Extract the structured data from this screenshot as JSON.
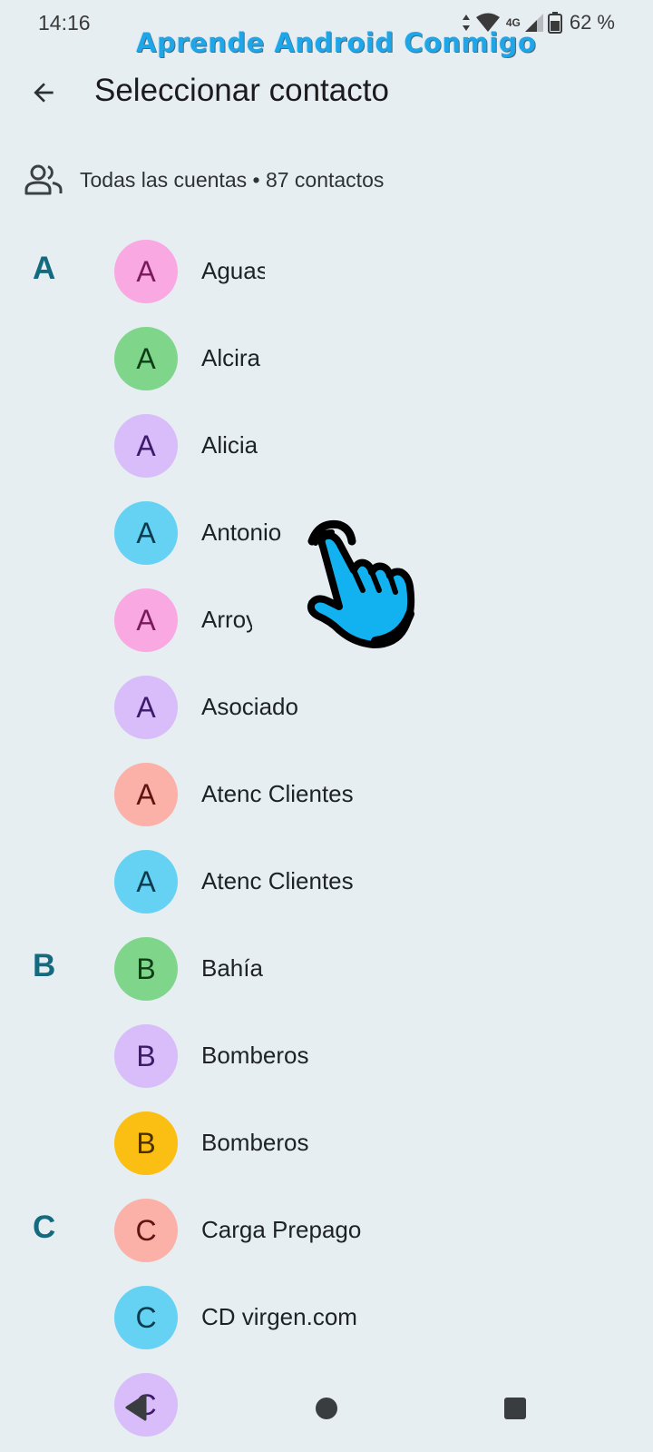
{
  "status_bar": {
    "time": "14:16",
    "network": "4G",
    "battery": "62 %"
  },
  "watermark": "Aprende Android Conmigo",
  "header": {
    "back_icon": "arrow-back-icon",
    "title": "Seleccionar contacto"
  },
  "account_filter": {
    "icon": "people-icon",
    "label": "Todas las cuentas • 87 contactos"
  },
  "contacts": [
    {
      "section": "A",
      "initial": "A",
      "name": "Aguas",
      "bg": "#f9a8e2",
      "fg": "#7a1a5e"
    },
    {
      "section": "",
      "initial": "A",
      "name": "Alcira",
      "bg": "#7fd68a",
      "fg": "#0f3d17"
    },
    {
      "section": "",
      "initial": "A",
      "name": "Alicia",
      "bg": "#d8bdfa",
      "fg": "#3e1a6a"
    },
    {
      "section": "",
      "initial": "A",
      "name": "Antonio",
      "bg": "#66d2f3",
      "fg": "#0b3b4d"
    },
    {
      "section": "",
      "initial": "A",
      "name": "Arroyo",
      "bg": "#f9a8e2",
      "fg": "#7a1a5e"
    },
    {
      "section": "",
      "initial": "A",
      "name": "Asociado",
      "bg": "#d8bdfa",
      "fg": "#3e1a6a"
    },
    {
      "section": "",
      "initial": "A",
      "name": "Atenc Clientes",
      "bg": "#fbb0a8",
      "fg": "#5e1410"
    },
    {
      "section": "",
      "initial": "A",
      "name": "Atenc Clientes",
      "bg": "#66d2f3",
      "fg": "#0b3b4d"
    },
    {
      "section": "B",
      "initial": "B",
      "name": "Bahía",
      "bg": "#7fd68a",
      "fg": "#0f3d17"
    },
    {
      "section": "",
      "initial": "B",
      "name": "Bomberos",
      "bg": "#d8bdfa",
      "fg": "#3e1a6a"
    },
    {
      "section": "",
      "initial": "B",
      "name": "Bomberos",
      "bg": "#fbbf14",
      "fg": "#4a3000"
    },
    {
      "section": "C",
      "initial": "C",
      "name": "Carga Prepago",
      "bg": "#fbb0a8",
      "fg": "#5e1410"
    },
    {
      "section": "",
      "initial": "C",
      "name": "CD virgen.com",
      "bg": "#66d2f3",
      "fg": "#0b3b4d"
    },
    {
      "section": "",
      "initial": "C",
      "name": "",
      "bg": "#d8bdfa",
      "fg": "#3e1a6a"
    }
  ],
  "overlay": {
    "pointer_icon": "hand-pointer-icon",
    "pointer_color": "#12b1f0"
  },
  "nav_bar": {
    "back_icon": "nav-back-icon",
    "home_icon": "nav-home-icon",
    "recents_icon": "nav-recents-icon"
  }
}
